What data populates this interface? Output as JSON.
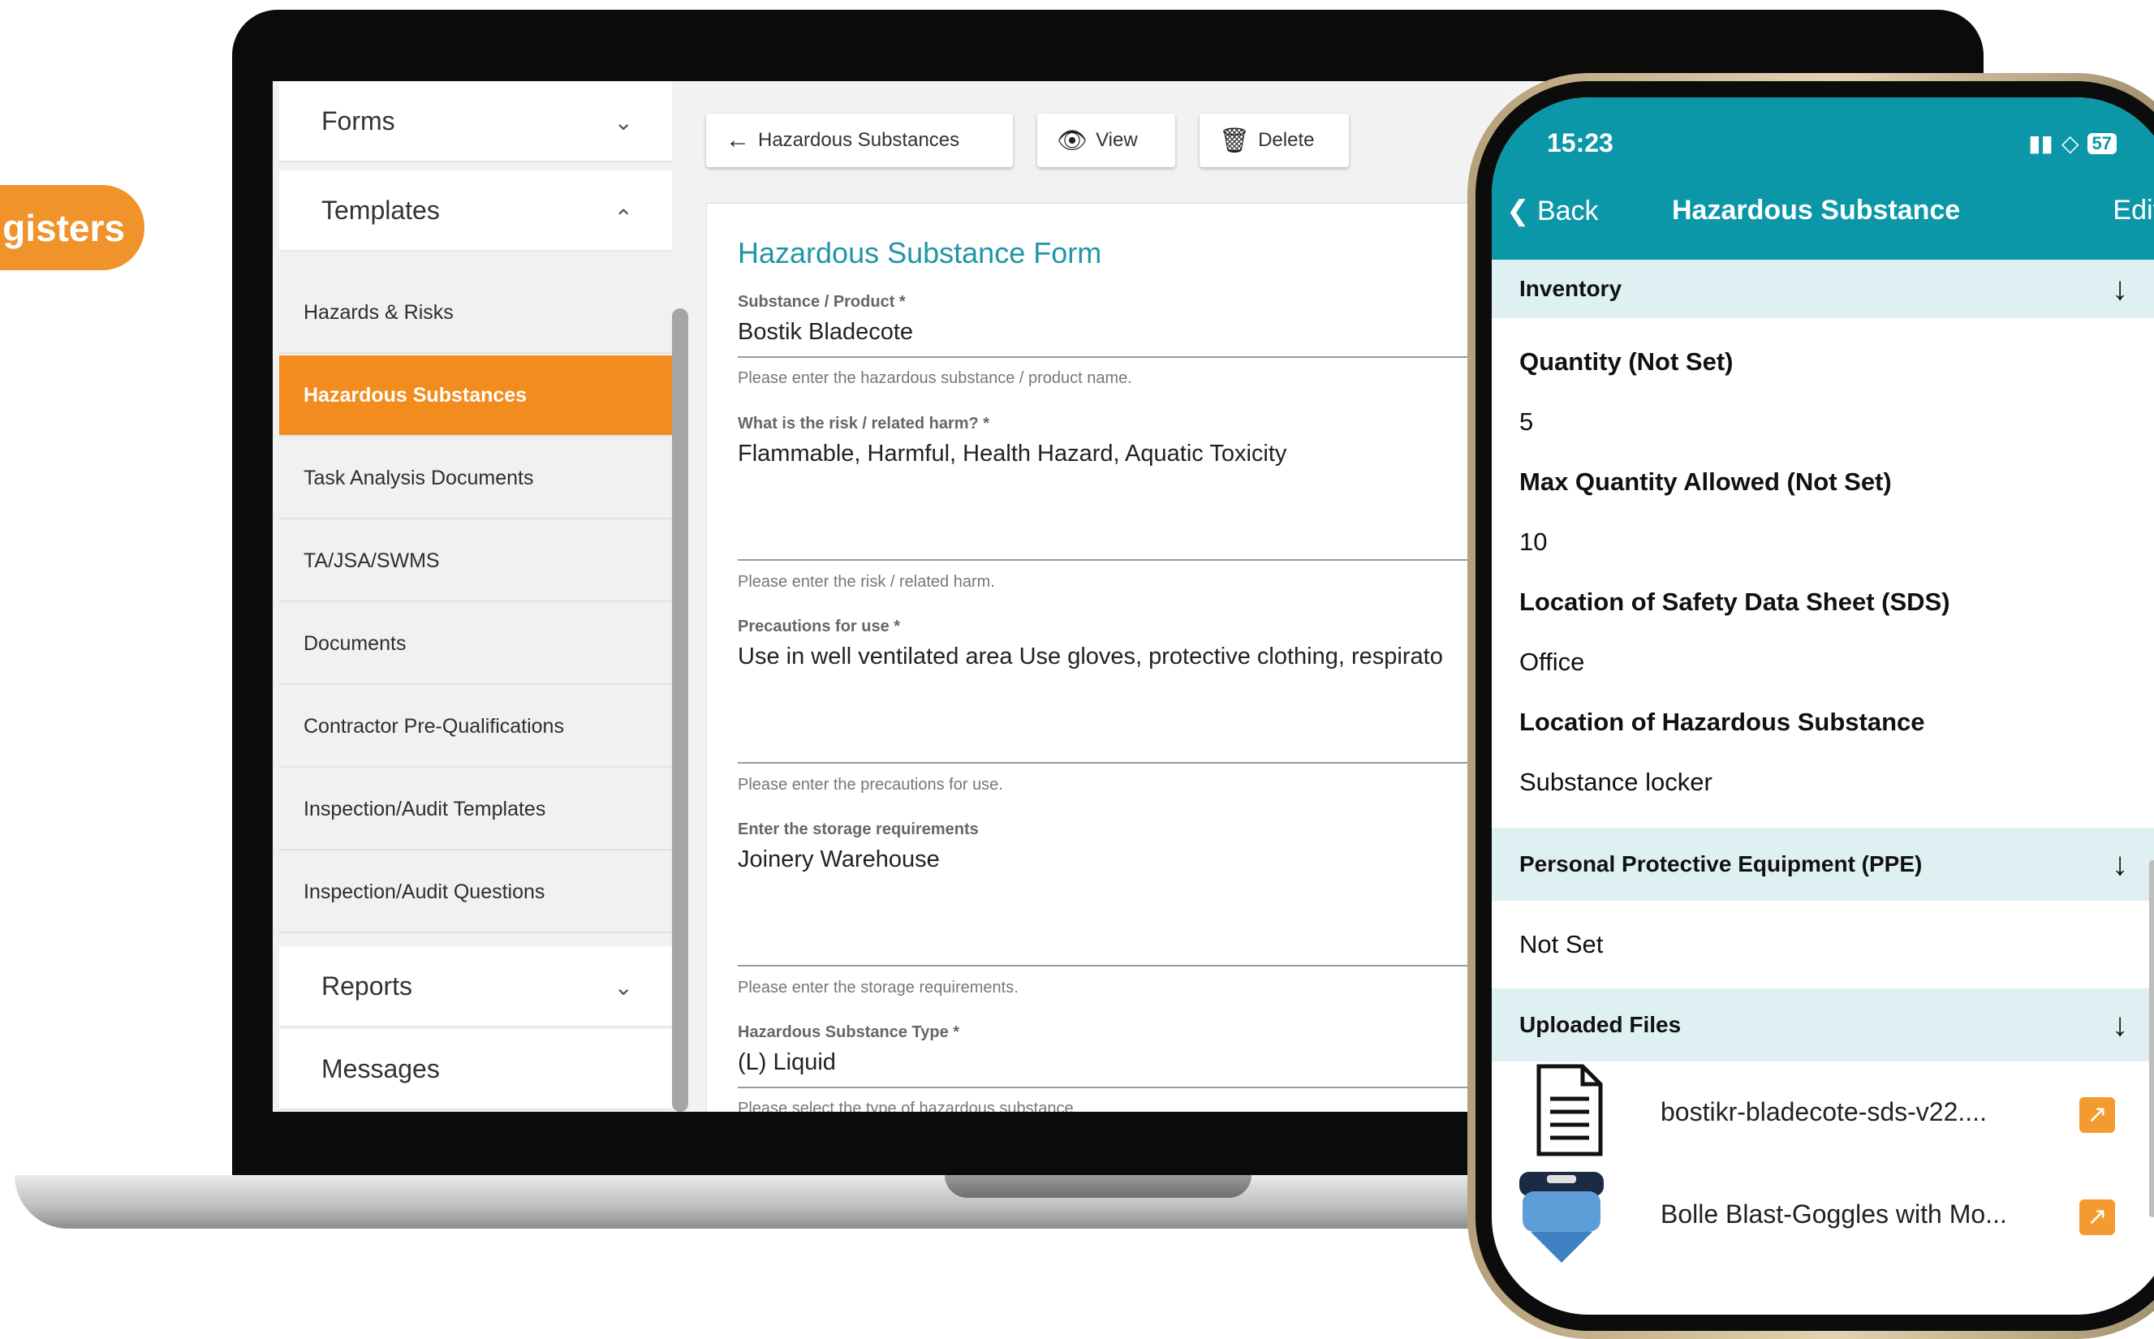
{
  "promo": {
    "pill_text": "gisters"
  },
  "sidebar": {
    "forms": "Forms",
    "templates": "Templates",
    "items": [
      {
        "label": "Hazards & Risks"
      },
      {
        "label": "Hazardous Substances"
      },
      {
        "label": "Task Analysis Documents"
      },
      {
        "label": "TA/JSA/SWMS"
      },
      {
        "label": "Documents"
      },
      {
        "label": "Contractor Pre-Qualifications"
      },
      {
        "label": "Inspection/Audit Templates"
      },
      {
        "label": "Inspection/Audit Questions"
      }
    ],
    "reports": "Reports",
    "messages": "Messages"
  },
  "toolbar": {
    "back_label": "Hazardous Substances",
    "view_label": "View",
    "delete_label": "Delete"
  },
  "form": {
    "title": "Hazardous Substance Form",
    "fields": [
      {
        "label": "Substance / Product *",
        "value": "Bostik  Bladecote",
        "hint": "Please enter the hazardous substance / product name."
      },
      {
        "label": "What is the risk / related harm? *",
        "value": "Flammable, Harmful, Health Hazard, Aquatic Toxicity",
        "hint": "Please enter the risk / related harm."
      },
      {
        "label": "Precautions for use *",
        "value": "Use in well ventilated area Use gloves, protective clothing, respirato",
        "hint": "Please enter the precautions for use."
      },
      {
        "label": "Enter the storage requirements",
        "value": "Joinery Warehouse",
        "hint": "Please enter the storage requirements."
      },
      {
        "label": "Hazardous Substance Type *",
        "value": "(L) Liquid",
        "hint": "Please select the type of hazardous substance"
      }
    ]
  },
  "phone": {
    "time": "15:23",
    "battery": "57",
    "nav": {
      "back": "Back",
      "title": "Hazardous Substance",
      "edit": "Edit"
    },
    "inventory": {
      "header": "Inventory",
      "rows": [
        {
          "label": "Quantity (Not Set)",
          "value": "5"
        },
        {
          "label": "Max Quantity Allowed (Not Set)",
          "value": "10"
        },
        {
          "label": "Location of Safety Data Sheet (SDS)",
          "value": "Office"
        },
        {
          "label": "Location of Hazardous Substance",
          "value": "Substance locker"
        }
      ]
    },
    "ppe": {
      "header": "Personal Protective Equipment (PPE)",
      "value": "Not Set"
    },
    "files": {
      "header": "Uploaded Files",
      "items": [
        {
          "name": "bostikr-bladecote-sds-v22...."
        },
        {
          "name": "Bolle Blast-Goggles with Mo..."
        }
      ]
    }
  }
}
